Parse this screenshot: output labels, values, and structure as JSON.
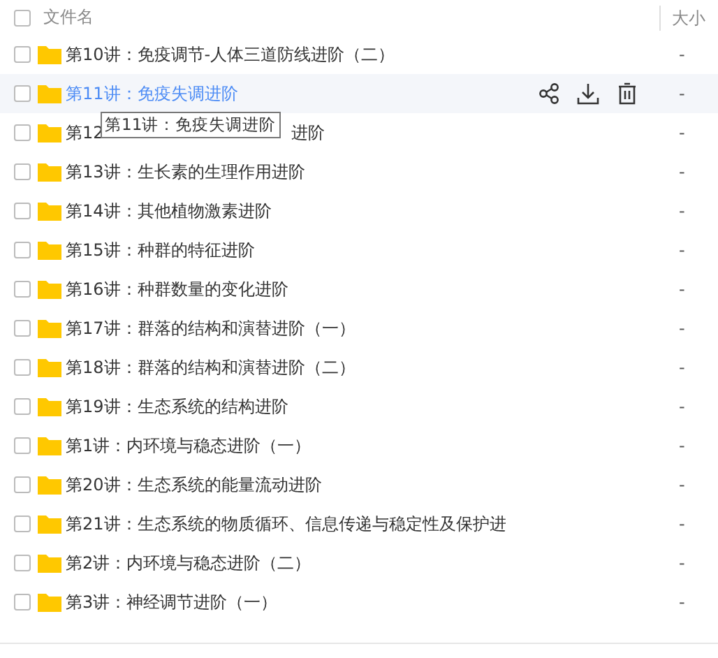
{
  "header": {
    "checked": false,
    "name_column": "文件名",
    "size_column": "大小"
  },
  "rows": [
    {
      "name": "第10讲：免疫调节-人体三道防线进阶（二）",
      "size": "-",
      "checked": false,
      "hovered": false
    },
    {
      "name": "第11讲：免疫失调进阶",
      "size": "-",
      "checked": false,
      "hovered": true
    },
    {
      "name": "第12",
      "name_tail": "进阶",
      "size": "-",
      "checked": false,
      "hovered": false
    },
    {
      "name": "第13讲：生长素的生理作用进阶",
      "size": "-",
      "checked": false,
      "hovered": false
    },
    {
      "name": "第14讲：其他植物激素进阶",
      "size": "-",
      "checked": false,
      "hovered": false
    },
    {
      "name": "第15讲：种群的特征进阶",
      "size": "-",
      "checked": false,
      "hovered": false
    },
    {
      "name": "第16讲：种群数量的变化进阶",
      "size": "-",
      "checked": false,
      "hovered": false
    },
    {
      "name": "第17讲：群落的结构和演替进阶（一）",
      "size": "-",
      "checked": false,
      "hovered": false
    },
    {
      "name": "第18讲：群落的结构和演替进阶（二）",
      "size": "-",
      "checked": false,
      "hovered": false
    },
    {
      "name": "第19讲：生态系统的结构进阶",
      "size": "-",
      "checked": false,
      "hovered": false
    },
    {
      "name": "第1讲：内环境与稳态进阶（一）",
      "size": "-",
      "checked": false,
      "hovered": false
    },
    {
      "name": "第20讲：生态系统的能量流动进阶",
      "size": "-",
      "checked": false,
      "hovered": false
    },
    {
      "name": "第21讲：生态系统的物质循环、信息传递与稳定性及保护进",
      "size": "-",
      "checked": false,
      "hovered": false
    },
    {
      "name": "第2讲：内环境与稳态进阶（二）",
      "size": "-",
      "checked": false,
      "hovered": false
    },
    {
      "name": "第3讲：神经调节进阶（一）",
      "size": "-",
      "checked": false,
      "hovered": false
    }
  ],
  "tooltip": {
    "text": "第11讲：免疫失调进阶"
  }
}
